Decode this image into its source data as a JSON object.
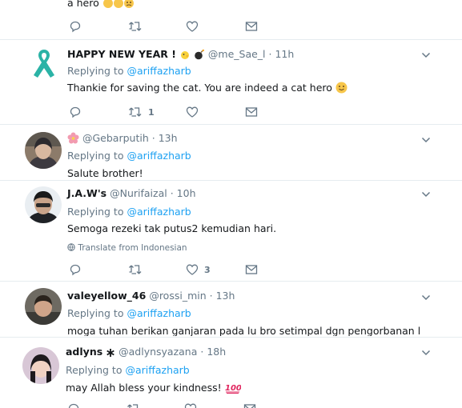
{
  "tweets": [
    {
      "text": "a hero",
      "actions": {
        "reply": "",
        "retweet": "",
        "like": ""
      }
    },
    {
      "name": "HAPPY NEW YEAR !",
      "handle": "@me_Sae_l",
      "dot": "·",
      "time": "11h",
      "replying_prefix": "Replying to",
      "replying_to": "@ariffazharb",
      "text": "Thankie for saving the cat. You are indeed a cat hero",
      "actions": {
        "retweet_count": "1"
      }
    },
    {
      "handle": "@Gebarputih",
      "dot": "·",
      "time": "13h",
      "replying_prefix": "Replying to",
      "replying_to": "@ariffazharb",
      "text": "Salute brother!"
    },
    {
      "name": "J.A.W's",
      "handle": "@Nurifaizal",
      "dot": "·",
      "time": "10h",
      "replying_prefix": "Replying to",
      "replying_to": "@ariffazharb",
      "text": "Semoga rezeki tak putus2 kemudian hari.",
      "translate": "Translate from Indonesian",
      "actions": {
        "like_count": "3"
      }
    },
    {
      "name": "valeyellow_46",
      "handle": "@rossi_min",
      "dot": "·",
      "time": "13h",
      "replying_prefix": "Replying to",
      "replying_to": "@ariffazharb",
      "text": "moga tuhan berikan ganjaran pada lu bro setimpal dgn pengorbanan lu tu"
    },
    {
      "name": "adlyns",
      "handle": "@adlynsyazana",
      "dot": "·",
      "time": "18h",
      "replying_prefix": "Replying to",
      "replying_to": "@ariffazharb",
      "text": "may Allah bless your kindness!"
    }
  ],
  "colors": {
    "link": "#1da1f2",
    "muted": "#657786",
    "text": "#14171a",
    "divider": "#e6ecf0",
    "ribbon": "#2bb3a6"
  },
  "icons": [
    "reply-icon",
    "retweet-icon",
    "like-icon",
    "message-icon",
    "caret-down-icon",
    "teal-ribbon-icon"
  ]
}
